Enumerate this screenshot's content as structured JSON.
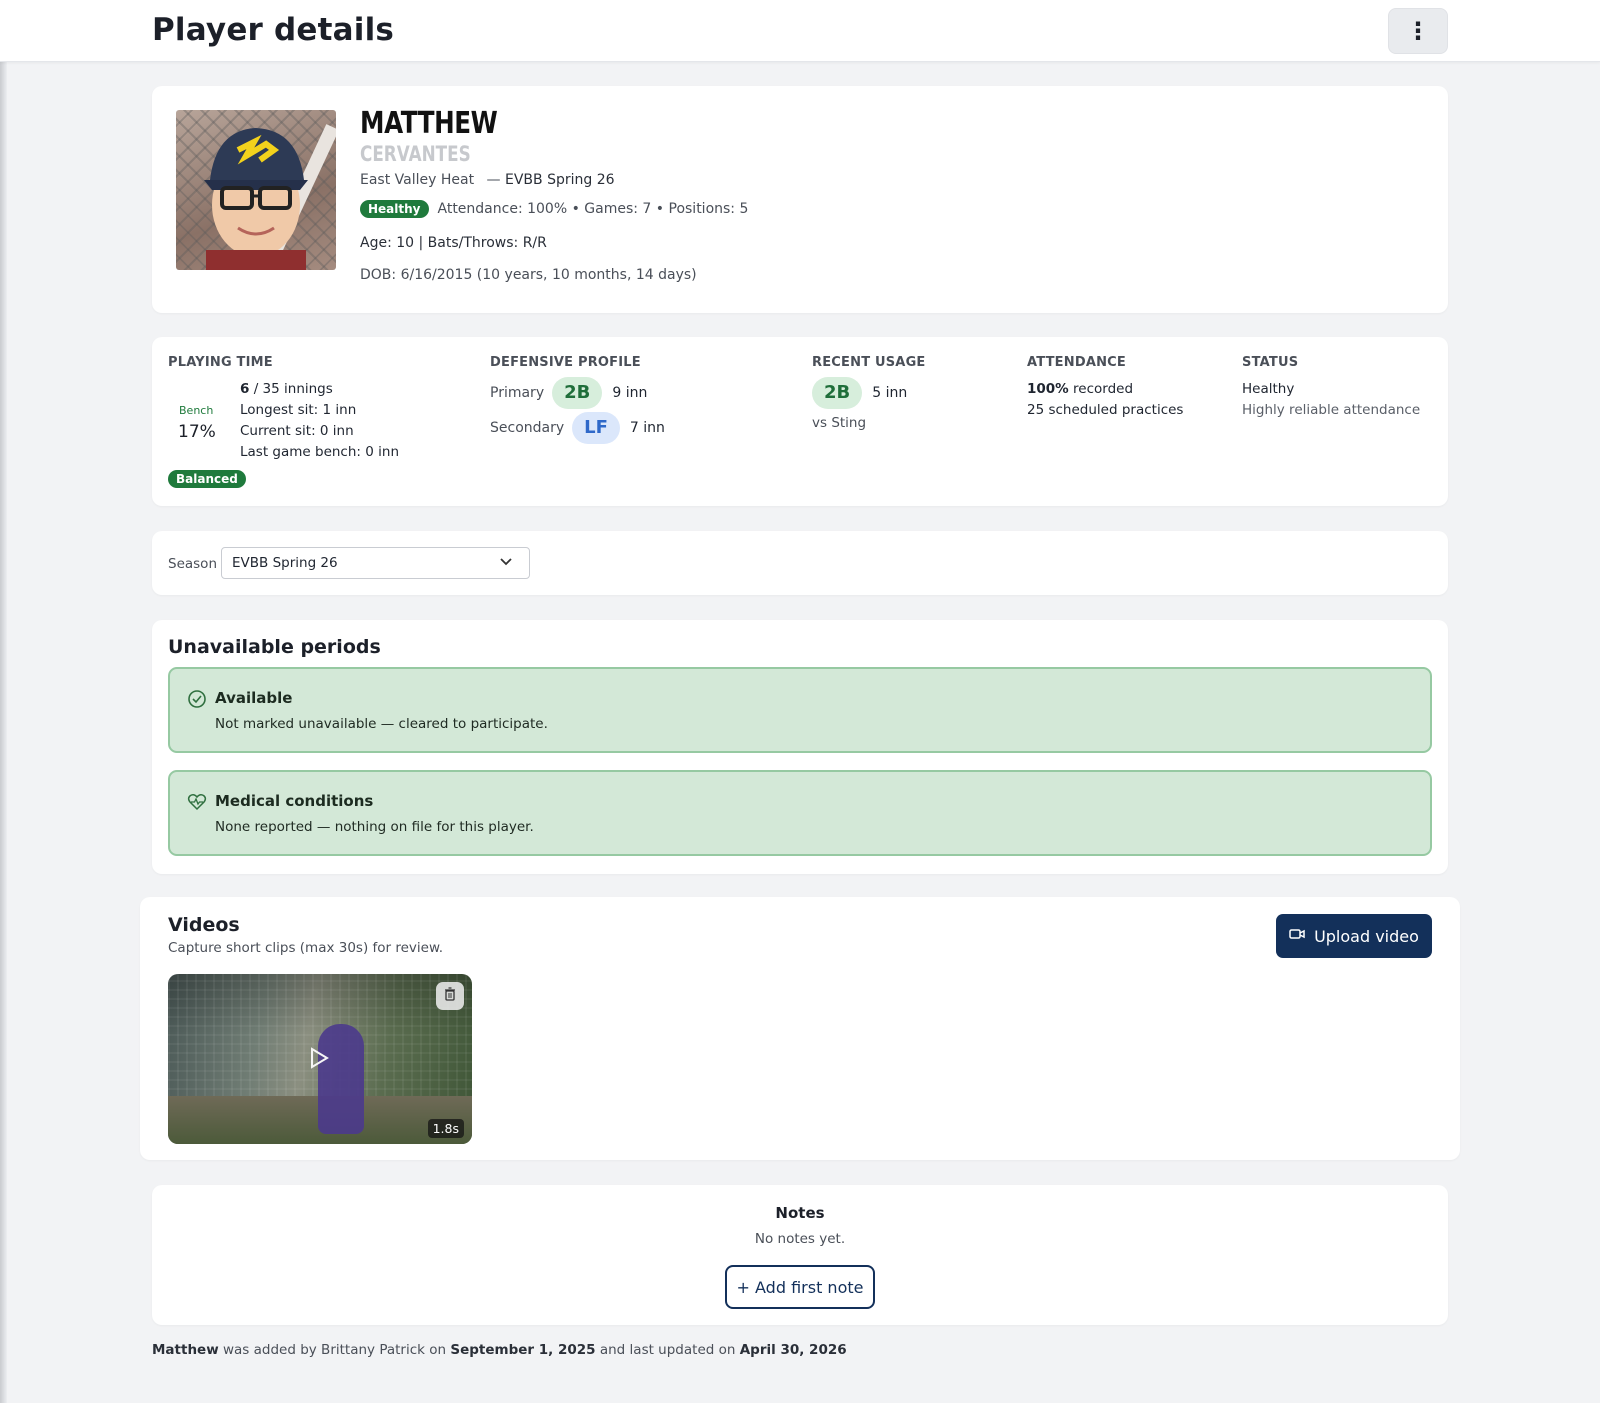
{
  "header": {
    "title": "Player details",
    "menu_icon": "⋮"
  },
  "player": {
    "first_name": "MATTHEW",
    "last_name": "CERVANTES",
    "team": "East Valley Heat",
    "season_sep": "—",
    "season": "EVBB Spring 26",
    "health_badge": "Healthy",
    "summary": "Attendance: 100% • Games: 7 • Positions: 5",
    "age_line": "Age: 10 | Bats/Throws: R/R",
    "dob_line": "DOB: 6/16/2015 (10 years, 10 months, 14 days)"
  },
  "stats": {
    "playing_time": {
      "title": "PLAYING TIME",
      "bench_label": "Bench",
      "bench_pct": "17%",
      "innings_bold": "6",
      "innings_rest": " / 35 innings",
      "longest_sit": "Longest sit: 1 inn",
      "current_sit": "Current sit: 0 inn",
      "last_game_bench": "Last game bench: 0 inn",
      "balance_badge": "Balanced"
    },
    "defensive": {
      "title": "DEFENSIVE PROFILE",
      "primary_label": "Primary",
      "primary_pos": "2B",
      "primary_inn": "9 inn",
      "secondary_label": "Secondary",
      "secondary_pos": "LF",
      "secondary_inn": "7 inn"
    },
    "recent": {
      "title": "RECENT USAGE",
      "pos": "2B",
      "inn": "5 inn",
      "opponent": "vs Sting"
    },
    "attendance": {
      "title": "ATTENDANCE",
      "pct": "100%",
      "pct_suffix": " recorded",
      "practices": "25 scheduled practices"
    },
    "status": {
      "title": "STATUS",
      "main": "Healthy",
      "sub": "Highly reliable attendance"
    }
  },
  "season_filter": {
    "label": "Season",
    "selected": "EVBB Spring 26"
  },
  "unavailable": {
    "title": "Unavailable periods",
    "available": {
      "title": "Available",
      "text": "Not marked unavailable — cleared to participate."
    },
    "medical": {
      "title": "Medical conditions",
      "text": "None reported — nothing on file for this player."
    }
  },
  "videos": {
    "title": "Videos",
    "subtitle": "Capture short clips (max 30s) for review.",
    "upload_label": "Upload video",
    "items": [
      {
        "duration": "1.8s"
      }
    ]
  },
  "notes": {
    "title": "Notes",
    "empty": "No notes yet.",
    "add_label": "+ Add first note"
  },
  "footer": {
    "name": "Matthew",
    "added_by": " was added by Brittany Patrick on ",
    "added_date": "September 1, 2025",
    "updated_text": " and last updated on ",
    "updated_date": "April 30, 2026"
  },
  "colors": {
    "brand_navy": "#13305a",
    "health_green": "#1f7a3c",
    "available_bg": "#d3e8d7"
  }
}
